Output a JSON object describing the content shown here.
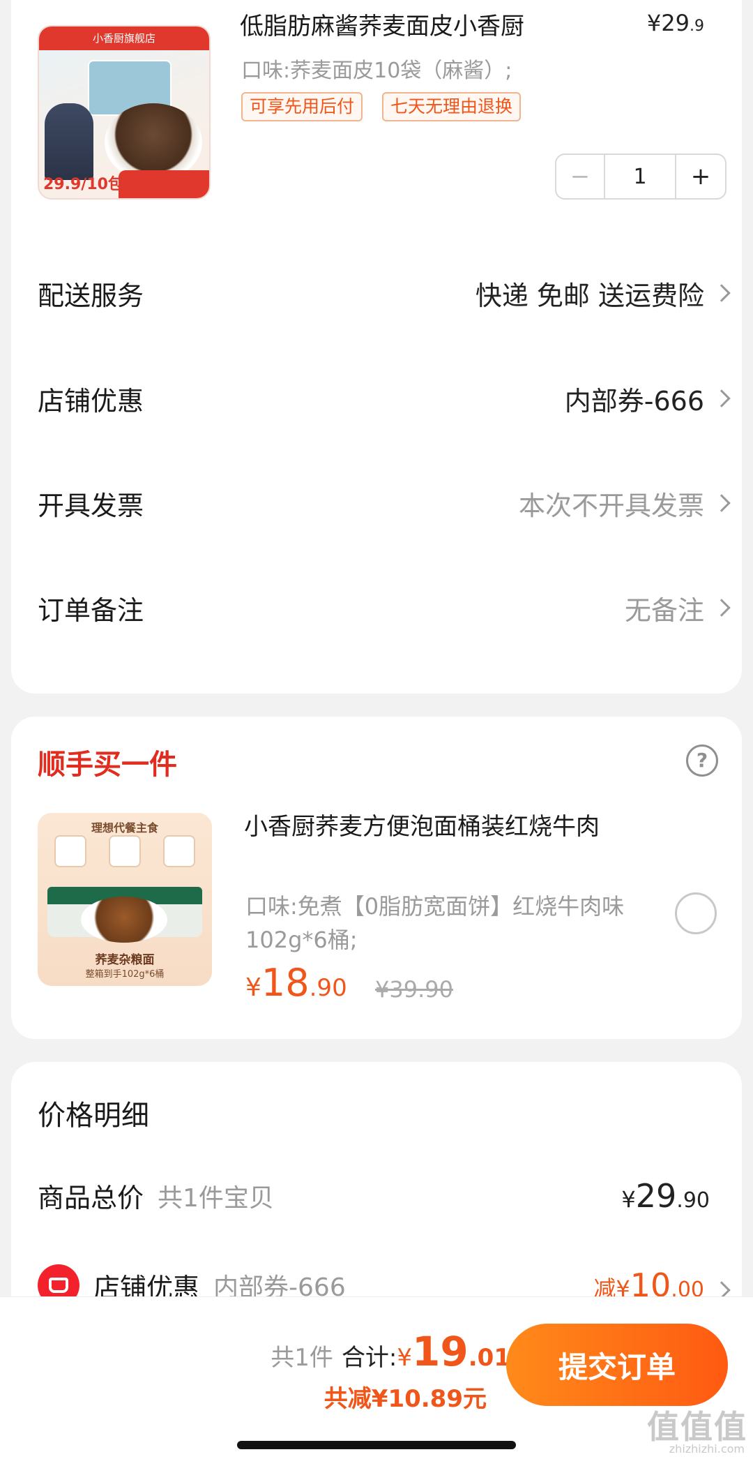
{
  "product": {
    "name": "低脂肪麻酱荞麦面皮小香厨",
    "price_main": "¥29",
    "price_decimal": ".9",
    "spec": "口味:荞麦面皮10袋（麻酱）;",
    "tags": [
      "可享先用后付",
      "七天无理由退换"
    ],
    "quantity": "1",
    "thumb_banner": "小香厨旗舰店",
    "thumb_price": "29.9/10包"
  },
  "options": [
    {
      "label": "配送服务",
      "value": "快递 免邮 送运费险"
    },
    {
      "label": "店铺优惠",
      "value": "内部券-666"
    },
    {
      "label": "开具发票",
      "value": "本次不开具发票"
    },
    {
      "label": "订单备注",
      "value": "无备注"
    }
  ],
  "addon": {
    "title": "顺手买一件",
    "name": "小香厨荞麦方便泡面桶装红烧牛肉",
    "spec": "口味:免煮【0脂肪宽面饼】红烧牛肉味102g*6桶;",
    "price_currency": "¥",
    "price_int": "18",
    "price_dec": ".90",
    "original_price": "¥39.90",
    "thumb_caption": "理想代餐主食",
    "thumb_label": "荞麦杂粮面",
    "thumb_sub": "整箱到手102g*6桶"
  },
  "detail": {
    "title": "价格明细",
    "total_label": "商品总价",
    "total_sub": "共1件宝贝",
    "total_currency": "¥",
    "total_int": "29",
    "total_dec": ".90",
    "shop_label": "店铺优惠",
    "shop_sub": "内部券-666",
    "shop_prefix": "减¥",
    "shop_int": "10",
    "shop_dec": ".00"
  },
  "bottom": {
    "count": "共1件",
    "total_label": "合计:",
    "total_currency": "¥",
    "total_int": "19",
    "total_dec": ".01",
    "saved": "共减¥10.89元",
    "submit": "提交订单"
  },
  "watermark": {
    "main": "值值值",
    "sub": "zhizhizhi.com"
  },
  "colors": {
    "accent": "#f0561a",
    "red": "#e02d1f",
    "button": "#ff6a14"
  },
  "icons": [
    "minus-icon",
    "plus-icon",
    "chevron-right-icon",
    "help-icon",
    "radio-icon",
    "shop-icon"
  ]
}
